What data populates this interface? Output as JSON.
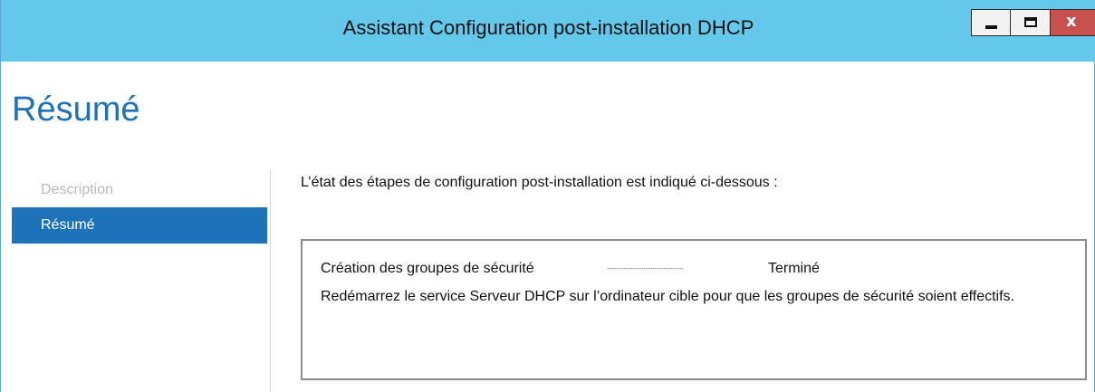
{
  "window": {
    "title": "Assistant Configuration post-installation DHCP",
    "close_label": "x"
  },
  "page": {
    "title": "Résumé"
  },
  "sidebar": {
    "items": [
      {
        "label": "Description",
        "state": "disabled"
      },
      {
        "label": "Résumé",
        "state": "selected"
      }
    ]
  },
  "main": {
    "intro": "L’état des étapes de configuration post-installation est indiqué ci-dessous :",
    "steps": [
      {
        "name": "Création des groupes de sécurité",
        "leader": "..........................................",
        "status": "Terminé"
      }
    ],
    "message": "Redémarrez le service Serveur DHCP sur l’ordinateur cible pour que les groupes de sécurité soient effectifs."
  },
  "colors": {
    "titlebar": "#63c8ea",
    "accent": "#1e73b8",
    "close": "#c7514f"
  }
}
